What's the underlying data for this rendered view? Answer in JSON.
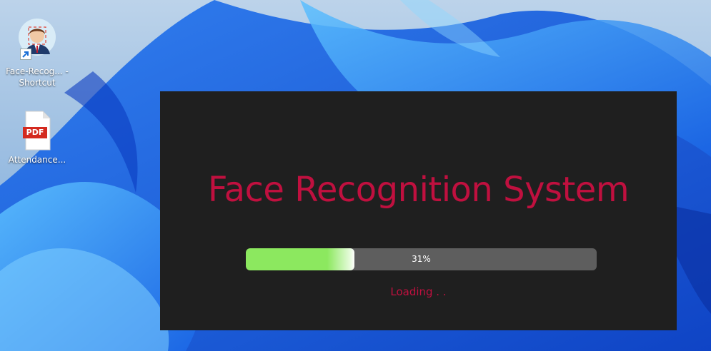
{
  "desktop": {
    "icons": [
      {
        "label": "Face-Recog... - Shortcut",
        "icon": "face-recognition-app-icon",
        "shortcut": true
      },
      {
        "label": "Attendance...",
        "icon": "pdf-file-icon",
        "badge": "PDF"
      }
    ]
  },
  "splash": {
    "title": "Face Recognition System",
    "progress": {
      "value": 31,
      "label": "31%"
    },
    "status": "Loading . ."
  },
  "colors": {
    "splash_bg": "#1f1f1f",
    "accent": "#c0103f",
    "progress_fill": "#8ce85f",
    "progress_track": "#5e5e5e"
  }
}
